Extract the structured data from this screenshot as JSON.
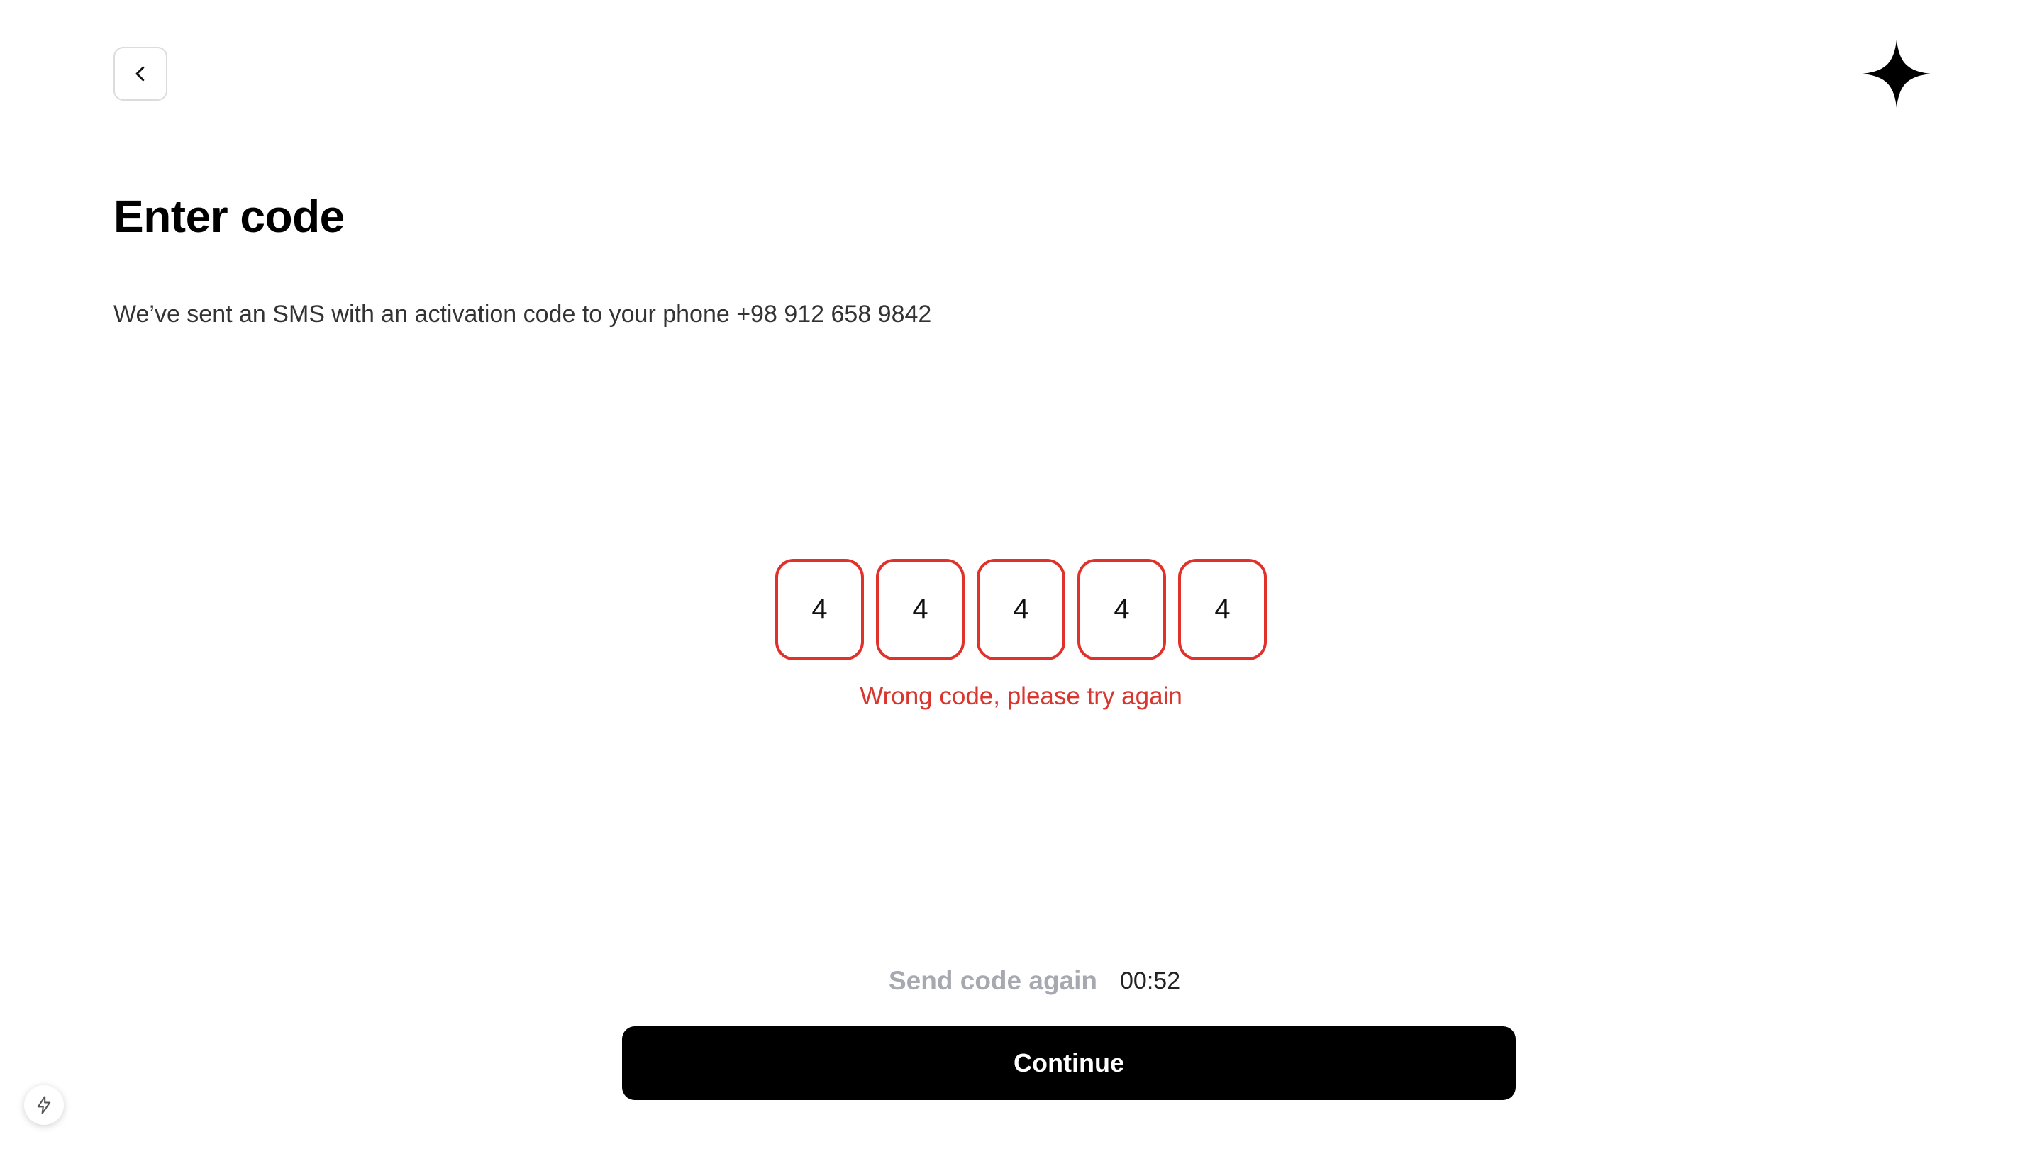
{
  "header": {
    "back_icon": "chevron-left-icon",
    "logo_icon": "four-point-star-icon"
  },
  "page": {
    "title": "Enter code",
    "subtitle": "We’ve sent an SMS with an activation code to your phone +98 912 658 9842"
  },
  "code_inputs": {
    "digits": [
      "4",
      "4",
      "4",
      "4",
      "4"
    ],
    "state": "error",
    "error_color": "#e0312b"
  },
  "error": {
    "message": "Wrong code, please try again"
  },
  "resend": {
    "label": "Send code again",
    "timer": "00:52"
  },
  "continue_button": {
    "label": "Continue"
  },
  "badge": {
    "icon": "lightning-bolt-icon"
  },
  "colors": {
    "primary": "#000000",
    "error": "#d9362f",
    "muted": "#a6a9b0"
  }
}
